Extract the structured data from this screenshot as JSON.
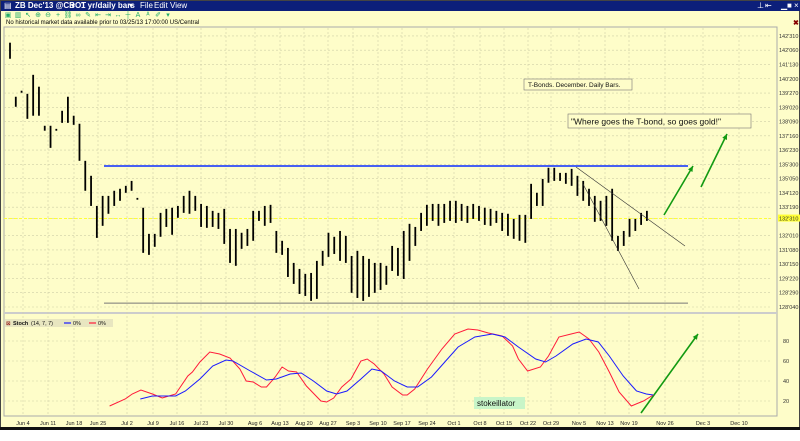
{
  "window": {
    "symbol": "ZB Dec'13 @CBOT",
    "interval": "1 yr/daily bars",
    "menu": [
      "File",
      "Edit",
      "View"
    ],
    "message": "No historical market data available prior to 03/25/13 17:00:00 US/Central"
  },
  "toolbar_icons": [
    "chart-icon",
    "bar-icon",
    "cursor-icon",
    "zoom-in-icon",
    "zoom-out-icon",
    "crosshair-icon",
    "link-icon",
    "unlink-icon",
    "draw-icon",
    "left-icon",
    "right-icon",
    "fit-icon",
    "center-icon",
    "text-icon",
    "label-icon",
    "pen-icon",
    "dropdown-icon"
  ],
  "annotations": {
    "title": "T-Bonds. December. Daily Bars.",
    "quote": "\"Where goes the T-bond, so goes gold!\"",
    "stoch_label": "stokeillator"
  },
  "indicator": {
    "name": "Stoch",
    "params": "(14, 7, 7)",
    "legend": [
      "0%",
      "0%"
    ]
  },
  "colors": {
    "resistance": "#0a2cff",
    "k_line": "#ff1a3a",
    "d_line": "#1a1aff",
    "arrow": "#129a12",
    "current": "#ffff33"
  },
  "chart_data": {
    "type": "ohlc-bar",
    "price_axis": [
      "142'310",
      "142'060",
      "141'130",
      "140'200",
      "139'270",
      "139'020",
      "138'090",
      "137'160",
      "136'230",
      "135'300",
      "135'050",
      "134'120",
      "133'190",
      "132'310",
      "132'010",
      "131'080",
      "130'150",
      "129'220",
      "128'290",
      "128'040"
    ],
    "current_price": "132'310",
    "date_axis": [
      "Jun 4",
      "Jun 11",
      "Jun 18",
      "Jun 25",
      "Jul 2",
      "Jul 9",
      "Jul 16",
      "Jul 23",
      "Jul 30",
      "Aug 6",
      "Aug 13",
      "Aug 20",
      "Aug 27",
      "Sep 3",
      "Sep 10",
      "Sep 17",
      "Sep 24",
      "Oct 1",
      "Oct 8",
      "Oct 15",
      "Oct 22",
      "Oct 29",
      "Nov 5",
      "Nov 13",
      "Nov 19",
      "Nov 26",
      "Dec 3",
      "Dec 10"
    ],
    "bars_high_low": [
      [
        142.6,
        141.72
      ],
      [
        139.64,
        139.09
      ],
      [
        139.97,
        139.86
      ],
      [
        139.8,
        138.43
      ],
      [
        140.84,
        138.6
      ],
      [
        140.19,
        138.6
      ],
      [
        138.05,
        137.78
      ],
      [
        138.05,
        136.84
      ],
      [
        137.88,
        137.78
      ],
      [
        138.87,
        138.21
      ],
      [
        139.64,
        138.21
      ],
      [
        138.6,
        138.1
      ],
      [
        138.16,
        136.13
      ],
      [
        136.13,
        134.49
      ],
      [
        135.31,
        133.66
      ],
      [
        133.66,
        131.91
      ],
      [
        134.21,
        132.57
      ],
      [
        134.21,
        133.23
      ],
      [
        134.49,
        133.66
      ],
      [
        134.6,
        133.94
      ],
      [
        134.76,
        134.38
      ],
      [
        135.03,
        134.49
      ],
      [
        134.1,
        134.0
      ],
      [
        133.56,
        131.09
      ],
      [
        132.13,
        130.98
      ],
      [
        132.13,
        131.42
      ],
      [
        133.28,
        131.97
      ],
      [
        133.5,
        132.51
      ],
      [
        133.56,
        132.08
      ],
      [
        133.66,
        133.01
      ],
      [
        134.21,
        133.28
      ],
      [
        134.49,
        133.23
      ],
      [
        134.21,
        133.39
      ],
      [
        133.77,
        132.51
      ],
      [
        133.66,
        132.46
      ],
      [
        133.39,
        132.51
      ],
      [
        133.28,
        132.4
      ],
      [
        133.5,
        131.58
      ],
      [
        132.4,
        130.54
      ],
      [
        132.4,
        130.38
      ],
      [
        132.19,
        131.31
      ],
      [
        132.4,
        131.47
      ],
      [
        133.39,
        131.75
      ],
      [
        133.39,
        132.84
      ],
      [
        133.66,
        132.57
      ],
      [
        133.72,
        132.73
      ],
      [
        132.29,
        131.09
      ],
      [
        131.75,
        130.98
      ],
      [
        131.36,
        129.77
      ],
      [
        130.54,
        129.39
      ],
      [
        130.21,
        128.84
      ],
      [
        129.94,
        128.73
      ],
      [
        129.99,
        128.46
      ],
      [
        130.65,
        128.57
      ],
      [
        131.2,
        130.38
      ],
      [
        132.19,
        130.87
      ],
      [
        131.97,
        131.03
      ],
      [
        132.29,
        130.65
      ],
      [
        132.02,
        130.54
      ],
      [
        130.92,
        128.9
      ],
      [
        131.2,
        128.62
      ],
      [
        130.92,
        128.46
      ],
      [
        130.76,
        128.68
      ],
      [
        130.54,
        128.9
      ],
      [
        130.54,
        129.06
      ],
      [
        130.38,
        129.34
      ],
      [
        131.47,
        130.1
      ],
      [
        131.36,
        129.83
      ],
      [
        132.29,
        129.66
      ],
      [
        132.68,
        130.65
      ],
      [
        132.51,
        131.47
      ],
      [
        133.28,
        132.29
      ],
      [
        133.72,
        132.57
      ],
      [
        133.77,
        132.84
      ],
      [
        133.77,
        132.57
      ],
      [
        133.77,
        132.73
      ],
      [
        133.94,
        132.84
      ],
      [
        133.94,
        132.73
      ],
      [
        133.77,
        132.84
      ],
      [
        133.66,
        132.73
      ],
      [
        133.77,
        132.95
      ],
      [
        133.66,
        132.84
      ],
      [
        133.56,
        132.62
      ],
      [
        133.5,
        132.57
      ],
      [
        133.39,
        132.73
      ],
      [
        133.28,
        132.29
      ],
      [
        133.23,
        132.02
      ],
      [
        132.95,
        131.86
      ],
      [
        133.17,
        131.75
      ],
      [
        133.17,
        131.64
      ],
      [
        134.87,
        132.95
      ],
      [
        134.38,
        133.66
      ],
      [
        135.14,
        133.66
      ],
      [
        135.75,
        134.93
      ],
      [
        135.75,
        135.03
      ],
      [
        135.47,
        135.03
      ],
      [
        135.47,
        134.87
      ],
      [
        135.69,
        134.76
      ],
      [
        135.31,
        134.21
      ],
      [
        135.03,
        133.94
      ],
      [
        134.6,
        133.66
      ],
      [
        134.21,
        132.79
      ],
      [
        133.94,
        132.84
      ],
      [
        134.21,
        132.57
      ],
      [
        134.6,
        131.75
      ],
      [
        132.02,
        131.2
      ],
      [
        132.29,
        131.47
      ],
      [
        132.95,
        131.97
      ],
      [
        132.95,
        132.29
      ],
      [
        133.28,
        132.62
      ],
      [
        133.39,
        132.84
      ]
    ],
    "resistance_price": 135.85,
    "support_price": 128.34,
    "stoch_axis": [
      80,
      60,
      40,
      20
    ],
    "stoch_k": [
      [
        17.2,
        15
      ],
      [
        19.9,
        22
      ],
      [
        21.1,
        27
      ],
      [
        22.6,
        31
      ],
      [
        24.6,
        27
      ],
      [
        26.3,
        23
      ],
      [
        28.6,
        27
      ],
      [
        30.7,
        45
      ],
      [
        31.5,
        49
      ],
      [
        32.8,
        59
      ],
      [
        34.5,
        69
      ],
      [
        36.2,
        67
      ],
      [
        38,
        63
      ],
      [
        39.7,
        52
      ],
      [
        40.8,
        40
      ],
      [
        42,
        39
      ],
      [
        43.4,
        34
      ],
      [
        44.3,
        34
      ],
      [
        45.8,
        44
      ],
      [
        47,
        54
      ],
      [
        48.1,
        50
      ],
      [
        49.5,
        49
      ],
      [
        51.2,
        35
      ],
      [
        53.7,
        20
      ],
      [
        54.7,
        19
      ],
      [
        55.9,
        23
      ],
      [
        57.3,
        34
      ],
      [
        58.9,
        42
      ],
      [
        60.6,
        60
      ],
      [
        61.7,
        62
      ],
      [
        62.9,
        57
      ],
      [
        64.6,
        47
      ],
      [
        66,
        34
      ],
      [
        67.8,
        26
      ],
      [
        68.6,
        26
      ],
      [
        69.9,
        32
      ],
      [
        72.1,
        52
      ],
      [
        74.6,
        72
      ],
      [
        76.8,
        87
      ],
      [
        79.1,
        92
      ],
      [
        80.8,
        91
      ],
      [
        82.6,
        88
      ],
      [
        85,
        85
      ],
      [
        86.8,
        75
      ],
      [
        87.8,
        62
      ],
      [
        89.4,
        50
      ],
      [
        91.6,
        54
      ],
      [
        93,
        65
      ],
      [
        94.8,
        84
      ],
      [
        96.9,
        87
      ],
      [
        98.3,
        89
      ],
      [
        100,
        82
      ],
      [
        101.7,
        69
      ],
      [
        103.5,
        49
      ],
      [
        105.2,
        29
      ],
      [
        107.3,
        15
      ],
      [
        109.4,
        20
      ],
      [
        111.1,
        26
      ]
    ],
    "stoch_d": [
      [
        22.5,
        22
      ],
      [
        24.6,
        25
      ],
      [
        28.6,
        25
      ],
      [
        30.3,
        30
      ],
      [
        32.8,
        42
      ],
      [
        35,
        55
      ],
      [
        37.3,
        61
      ],
      [
        38.5,
        60
      ],
      [
        41.5,
        50
      ],
      [
        44.3,
        41
      ],
      [
        46,
        42
      ],
      [
        48.4,
        47
      ],
      [
        50.3,
        48
      ],
      [
        52.4,
        40
      ],
      [
        54.7,
        30
      ],
      [
        56.4,
        27
      ],
      [
        58.2,
        30
      ],
      [
        60.6,
        42
      ],
      [
        62.5,
        52
      ],
      [
        64.1,
        50
      ],
      [
        66.4,
        40
      ],
      [
        68.6,
        34
      ],
      [
        70.4,
        34
      ],
      [
        72.8,
        44
      ],
      [
        75.1,
        59
      ],
      [
        77.4,
        74
      ],
      [
        80.3,
        84
      ],
      [
        83.3,
        87
      ],
      [
        85.5,
        84
      ],
      [
        87.8,
        74
      ],
      [
        90.8,
        62
      ],
      [
        92.5,
        59
      ],
      [
        94.3,
        65
      ],
      [
        97.2,
        77
      ],
      [
        99.5,
        82
      ],
      [
        101.6,
        79
      ],
      [
        103.5,
        65
      ],
      [
        105.9,
        45
      ],
      [
        108.2,
        30
      ],
      [
        109.9,
        27
      ],
      [
        111.1,
        26
      ]
    ]
  }
}
